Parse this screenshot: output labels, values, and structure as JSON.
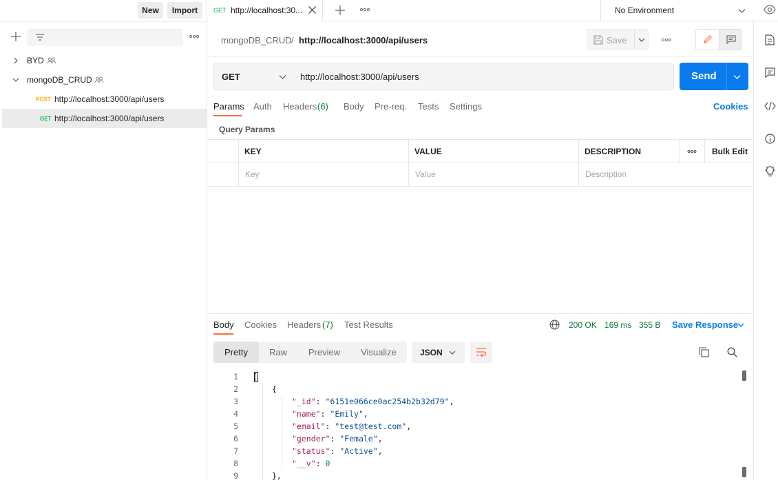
{
  "sidebar": {
    "new_label": "New",
    "import_label": "Import",
    "collections": [
      {
        "name": "BYD",
        "expanded": false
      },
      {
        "name": "mongoDB_CRUD",
        "expanded": true
      }
    ],
    "requests": [
      {
        "method": "POST",
        "url": "http://localhost:3000/api/users",
        "selected": false
      },
      {
        "method": "GET",
        "url": "http://localhost:3000/api/users",
        "selected": true
      }
    ]
  },
  "tabbar": {
    "active_tab_method": "GET",
    "active_tab_title": "http://localhost:30...",
    "environment": "No Environment"
  },
  "request": {
    "breadcrumb_collection": "mongoDB_CRUD",
    "breadcrumb_sep": "/",
    "breadcrumb_request": "http://localhost:3000/api/users",
    "save_label": "Save",
    "method": "GET",
    "url": "http://localhost:3000/api/users",
    "send_label": "Send",
    "tabs": {
      "params": "Params",
      "auth": "Auth",
      "headers": "Headers",
      "headers_count": "(6)",
      "body": "Body",
      "prereq": "Pre-req.",
      "tests": "Tests",
      "settings": "Settings"
    },
    "cookies_label": "Cookies",
    "query_params_label": "Query Params",
    "params_table": {
      "col_key": "KEY",
      "col_value": "VALUE",
      "col_description": "DESCRIPTION",
      "bulk_edit": "Bulk Edit",
      "placeholder_key": "Key",
      "placeholder_value": "Value",
      "placeholder_description": "Description"
    }
  },
  "response": {
    "tabs": {
      "body": "Body",
      "cookies": "Cookies",
      "headers": "Headers",
      "headers_count": "(7)",
      "test_results": "Test Results"
    },
    "status": "200 OK",
    "time": "169 ms",
    "size": "355 B",
    "save_response": "Save Response",
    "format_tabs": {
      "pretty": "Pretty",
      "raw": "Raw",
      "preview": "Preview",
      "visualize": "Visualize"
    },
    "format": "JSON",
    "line_numbers": [
      "1",
      "2",
      "3",
      "4",
      "5",
      "6",
      "7",
      "8",
      "9"
    ],
    "body": {
      "id_key": "\"_id\"",
      "id_val": "\"6151e066ce0ac254b2b32d79\"",
      "name_key": "\"name\"",
      "name_val": "\"Emily\"",
      "email_key": "\"email\"",
      "email_val": "\"test@test.com\"",
      "gender_key": "\"gender\"",
      "gender_val": "\"Female\"",
      "status_key": "\"status\"",
      "status_val": "\"Active\"",
      "v_key": "\"__v\"",
      "v_val": "0"
    }
  },
  "colors": {
    "accent": "#097bed",
    "active_tab_underline": "#ff6c37",
    "status_ok": "#0c7d38",
    "post": "#ffad0d",
    "get": "#0cbb52"
  }
}
